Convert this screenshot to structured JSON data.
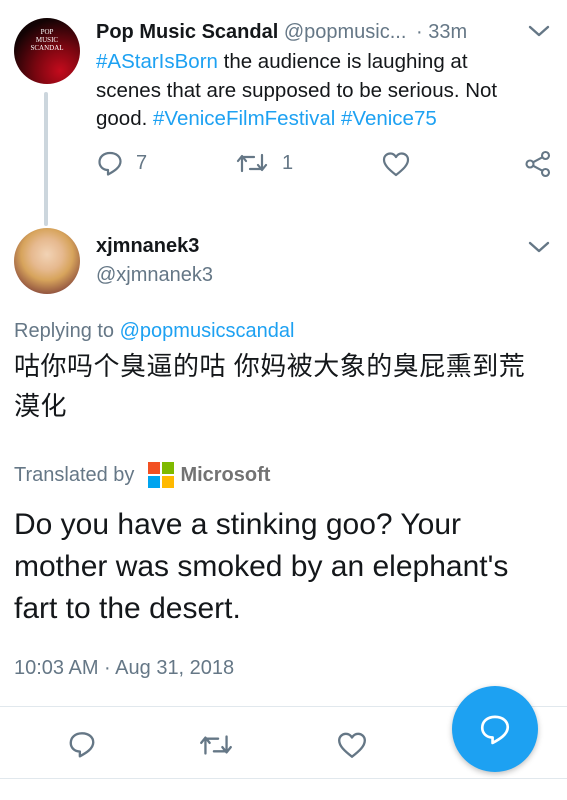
{
  "parent_tweet": {
    "display_name": "Pop Music Scandal",
    "handle": "@popmusic...",
    "dot": "·",
    "time": "33m",
    "avatar_text": [
      "POP",
      "MUSIC",
      "SCANDAL"
    ],
    "text_parts": {
      "tag1": "#AStarIsBorn",
      "body1": " the audience is laughing at scenes that are supposed to be serious. Not good. ",
      "tag2": "#VeniceFilmFestival",
      "space": " ",
      "tag3": "#Venice75"
    },
    "reply_count": "7",
    "retweet_count": "1"
  },
  "main_tweet": {
    "display_name": "xjmnanek3",
    "handle": "@xjmnanek3",
    "replying_prefix": "Replying to ",
    "replying_to": "@popmusicscandal",
    "text": "咕你吗个臭逼的咕 你妈被大象的臭屁熏到荒漠化",
    "translated_by": "Translated by",
    "translator": "Microsoft",
    "translation": "Do you have a stinking goo? Your mother was smoked by an elephant's fart to the desert.",
    "timestamp": "10:03 AM · Aug 31, 2018"
  },
  "colors": {
    "accent": "#1da1f2",
    "muted": "#657786",
    "ms_red": "#f25022",
    "ms_green": "#7fba00",
    "ms_blue": "#00a4ef",
    "ms_yellow": "#ffb900"
  },
  "icons": [
    "reply-icon",
    "retweet-icon",
    "like-icon",
    "share-icon",
    "chevron-down-icon",
    "compose-icon"
  ]
}
